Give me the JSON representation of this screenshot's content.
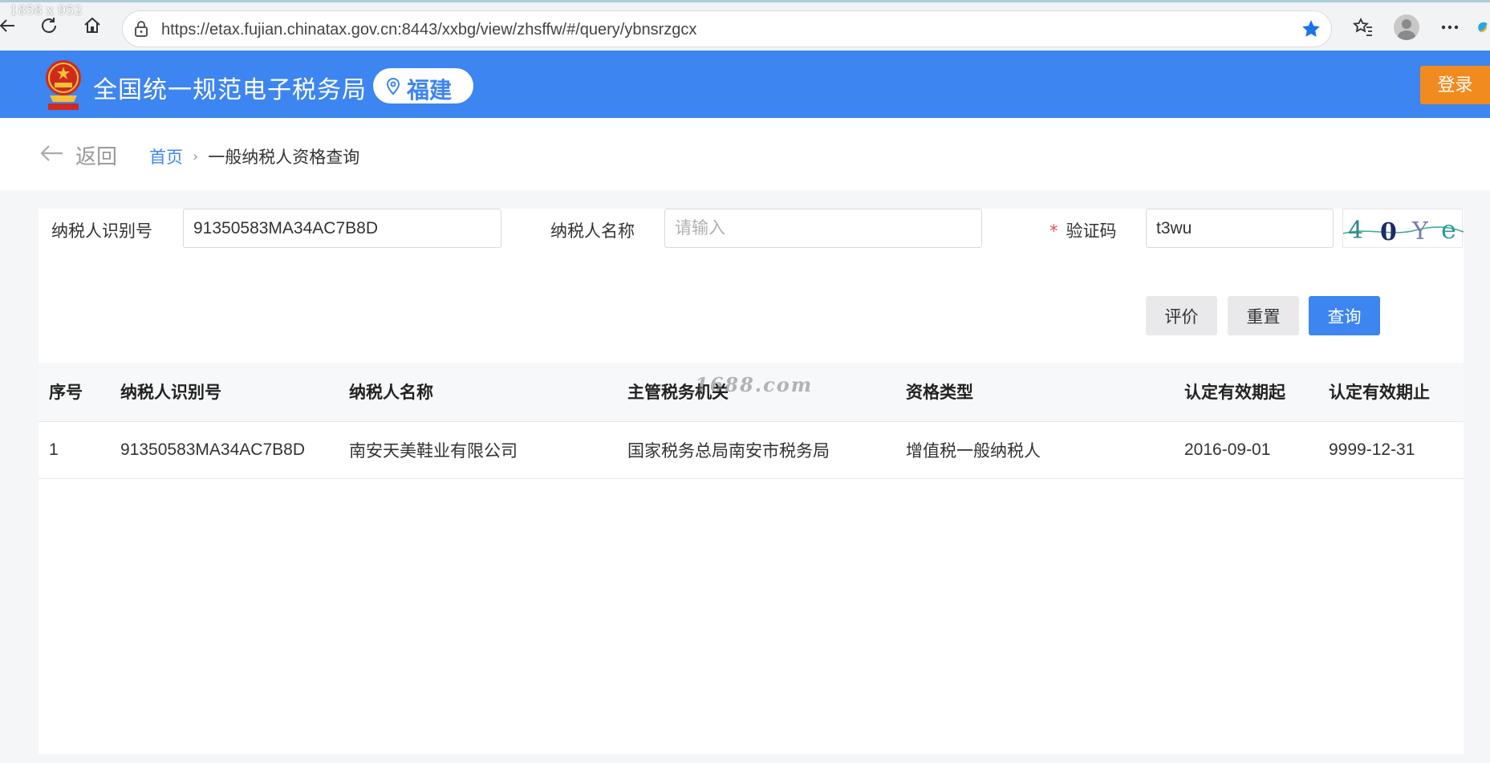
{
  "browser": {
    "dim_label": "1858 x 952",
    "url": "https://etax.fujian.chinatax.gov.cn:8443/xxbg/view/zhsffw/#/query/ybnsrzgcx"
  },
  "header": {
    "site_title": "全国统一规范电子税务局",
    "region": "福建",
    "login_label": "登录",
    "brand_color": "#3d85f0",
    "login_color": "#f28b1f"
  },
  "breadcrumb": {
    "back_label": "返回",
    "home": "首页",
    "separator": "›",
    "current": "一般纳税人资格查询"
  },
  "form": {
    "taxpayer_id_label": "纳税人识别号",
    "taxpayer_id_value": "91350583MA34AC7B8D",
    "taxpayer_name_label": "纳税人名称",
    "taxpayer_name_placeholder": "请输入",
    "captcha_required_mark": "*",
    "captcha_label": "验证码",
    "captcha_value": "t3wu",
    "captcha_image_text": "4 0 Y e"
  },
  "buttons": {
    "evaluate": "评价",
    "reset": "重置",
    "query": "查询"
  },
  "table": {
    "columns": [
      "序号",
      "纳税人识别号",
      "纳税人名称",
      "主管税务机关",
      "资格类型",
      "认定有效期起",
      "认定有效期止"
    ],
    "rows": [
      [
        "1",
        "91350583MA34AC7B8D",
        "南安天美鞋业有限公司",
        "国家税务总局南安市税务局",
        "增值税一般纳税人",
        "2016-09-01",
        "9999-12-31"
      ]
    ]
  },
  "watermark": "1688.com"
}
